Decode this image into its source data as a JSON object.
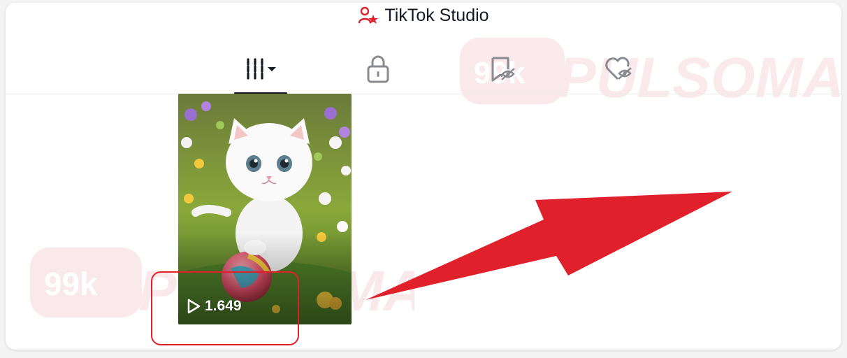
{
  "header": {
    "title": "TikTok Studio",
    "icon": "person-star-icon"
  },
  "tabs": [
    {
      "icon": "grid-sort-icon",
      "active": true
    },
    {
      "icon": "lock-icon",
      "active": false
    },
    {
      "icon": "hidden-bookmark-icon",
      "active": false
    },
    {
      "icon": "hidden-heart-icon",
      "active": false
    }
  ],
  "video": {
    "views": "1.649",
    "play_icon": "play-icon"
  },
  "watermark": {
    "text": "PULSOMAX",
    "badge": "99k"
  },
  "colors": {
    "accent": "#e0202a",
    "text": "#161823",
    "icon": "#8a8b91"
  }
}
